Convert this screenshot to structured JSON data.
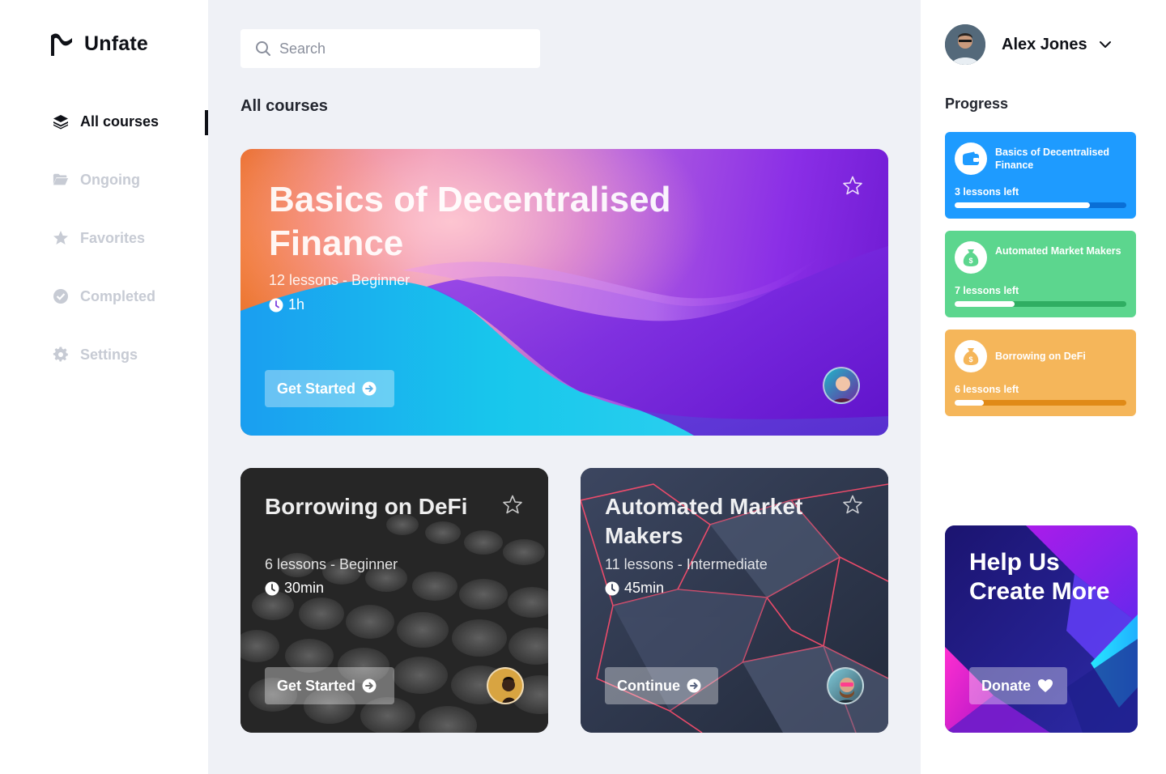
{
  "app": {
    "name": "Unfate"
  },
  "sidebar": {
    "items": [
      {
        "label": "All courses",
        "icon": "layers-icon",
        "active": true
      },
      {
        "label": "Ongoing",
        "icon": "folder-icon",
        "active": false
      },
      {
        "label": "Favorites",
        "icon": "star-icon",
        "active": false
      },
      {
        "label": "Completed",
        "icon": "check-circle-icon",
        "active": false
      },
      {
        "label": "Settings",
        "icon": "gear-icon",
        "active": false
      }
    ]
  },
  "search": {
    "placeholder": "Search",
    "value": ""
  },
  "main": {
    "section_title": "All courses",
    "courses": [
      {
        "title": "Basics of Decentralised Finance",
        "meta": "12 lessons - Beginner",
        "duration": "1h",
        "button": "Get Started"
      },
      {
        "title": "Borrowing on DeFi",
        "meta": "6 lessons - Beginner",
        "duration": "30min",
        "button": "Get Started"
      },
      {
        "title": "Automated Market Makers",
        "meta": "11 lessons - Intermediate",
        "duration": "45min",
        "button": "Continue"
      }
    ]
  },
  "user": {
    "name": "Alex Jones"
  },
  "progress": {
    "title": "Progress",
    "items": [
      {
        "title": "Basics of Decentralised Finance",
        "lessons_left": "3 lessons left",
        "fraction": 0.79,
        "color": "#1e9bff",
        "track": "#0a6fd6",
        "icon": "wallet-icon"
      },
      {
        "title": "Automated Market Makers",
        "lessons_left": "7 lessons left",
        "fraction": 0.35,
        "color": "#5cd68e",
        "track": "#2fae62",
        "icon": "money-bag-icon"
      },
      {
        "title": "Borrowing on DeFi",
        "lessons_left": "6 lessons left",
        "fraction": 0.17,
        "color": "#f5b65a",
        "track": "#e08a17",
        "icon": "money-bag-icon"
      }
    ]
  },
  "donate": {
    "title": "Help Us Create More",
    "button": "Donate"
  }
}
